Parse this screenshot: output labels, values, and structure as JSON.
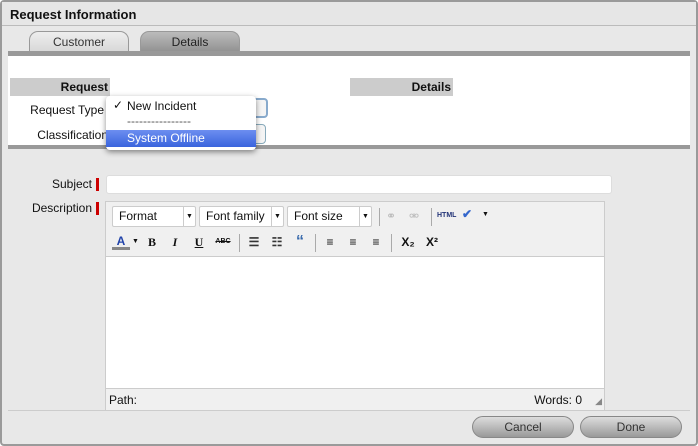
{
  "window": {
    "title": "Request Information"
  },
  "tabs": [
    {
      "label": "Customer"
    },
    {
      "label": "Details"
    }
  ],
  "sections": {
    "request": "Request",
    "details": "Details"
  },
  "fields": {
    "request_type_label": "Request Type",
    "classification_label": "Classification",
    "subject_label": "Subject",
    "description_label": "Description"
  },
  "dropdown": {
    "options": [
      "New Incident",
      "----------------",
      "System Offline"
    ],
    "checked": "New Incident",
    "highlighted": "System Offline",
    "check": "✓"
  },
  "editor": {
    "format": "Format",
    "font_family": "Font family",
    "font_size": "Font size",
    "html": "HTML",
    "path": "Path:",
    "words": "Words: 0",
    "bold": "B",
    "italic": "I",
    "underline": "U",
    "strike": "ABC",
    "subscript": "X₂",
    "superscript": "X²",
    "quote": "“"
  },
  "buttons": {
    "cancel": "Cancel",
    "done": "Done"
  },
  "colors": {
    "highlight": "#3a64dd",
    "required": "#cc0000"
  }
}
